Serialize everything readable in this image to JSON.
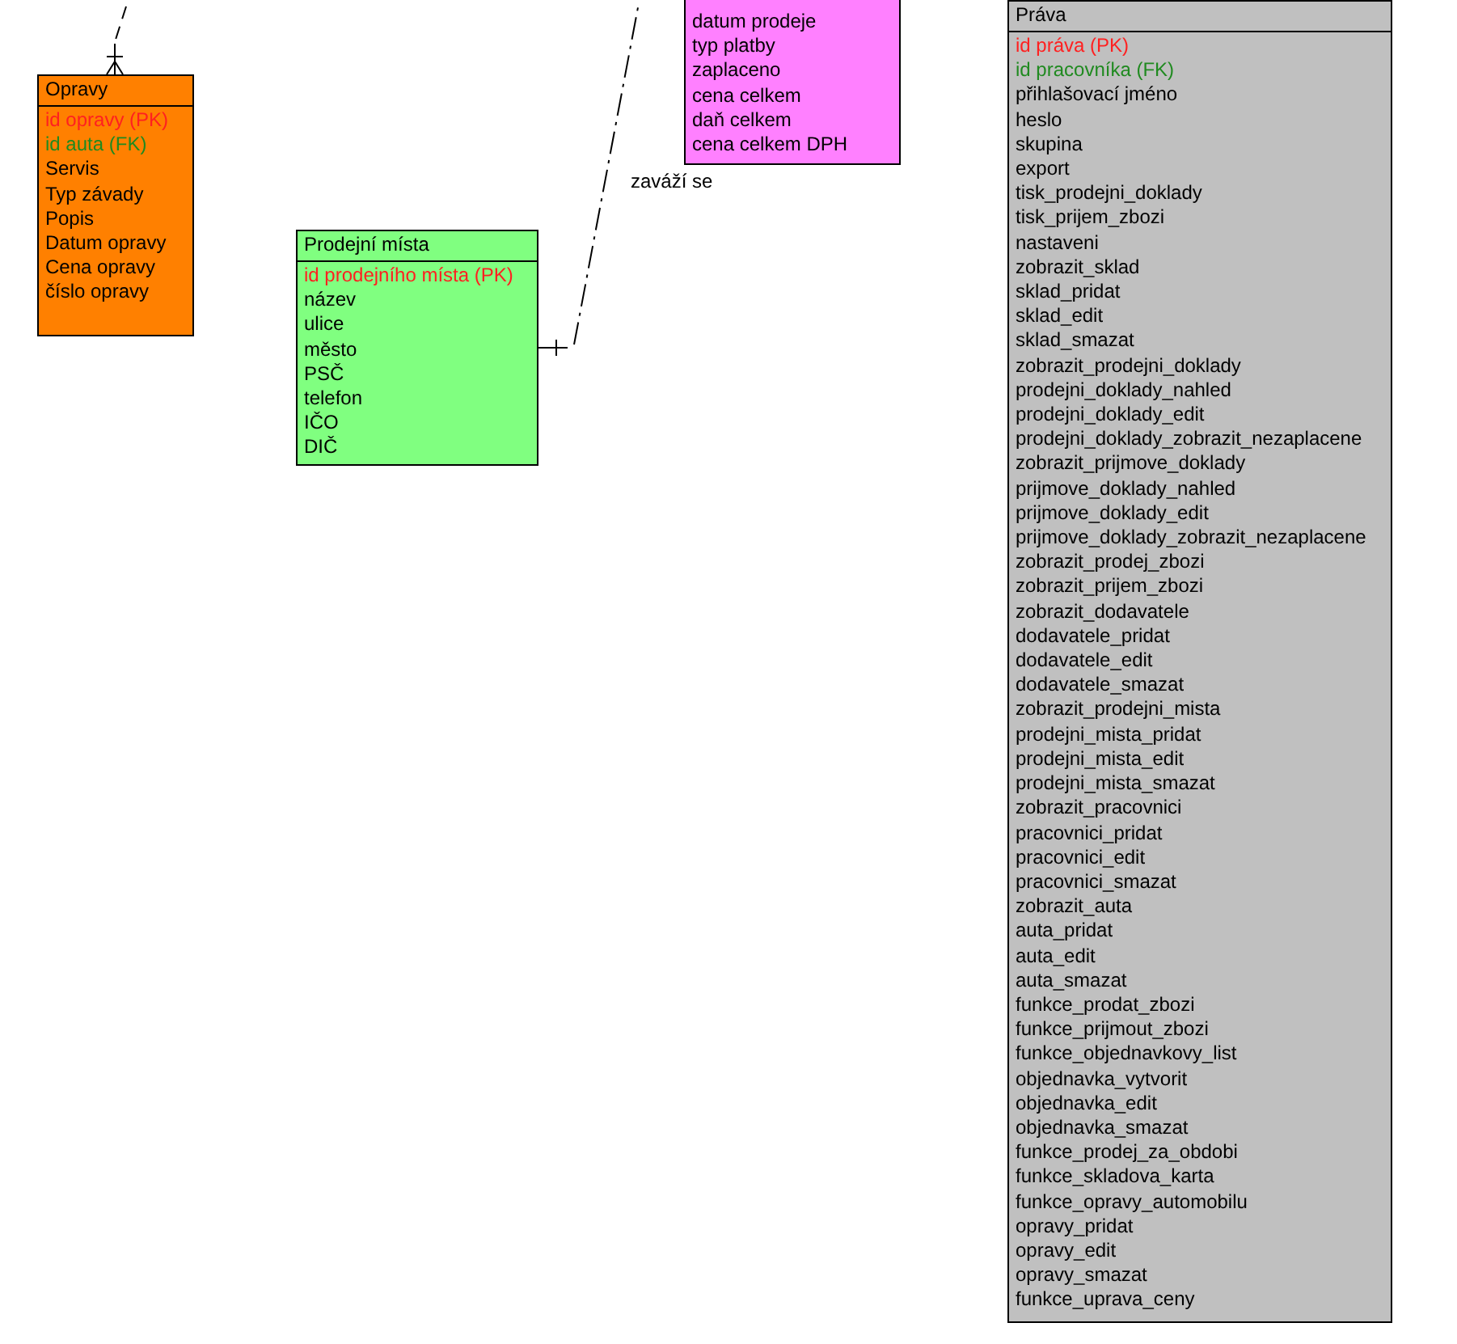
{
  "entities": [
    {
      "title": "Opravy",
      "color": "#ff8000",
      "rows": [
        {
          "text": "id opravy (PK)",
          "kind": "pk"
        },
        {
          "text": "id auta (FK)",
          "kind": "fk"
        },
        {
          "text": "Servis",
          "kind": "attr"
        },
        {
          "text": "Typ závady",
          "kind": "attr"
        },
        {
          "text": "Popis",
          "kind": "attr"
        },
        {
          "text": "Datum opravy",
          "kind": "attr"
        },
        {
          "text": "Cena opravy",
          "kind": "attr"
        },
        {
          "text": "číslo opravy",
          "kind": "attr"
        }
      ]
    },
    {
      "title": "Prodejní místa",
      "color": "#80ff80",
      "rows": [
        {
          "text": "id prodejního místa (PK)",
          "kind": "pk"
        },
        {
          "text": "název",
          "kind": "attr"
        },
        {
          "text": "ulice",
          "kind": "attr"
        },
        {
          "text": "město",
          "kind": "attr"
        },
        {
          "text": "PSČ",
          "kind": "attr"
        },
        {
          "text": "telefon",
          "kind": "attr"
        },
        {
          "text": "IČO",
          "kind": "attr"
        },
        {
          "text": "DIČ",
          "kind": "attr"
        }
      ]
    },
    {
      "color": "#ff80ff",
      "rows": [
        {
          "text": "datum prodeje",
          "kind": "attr"
        },
        {
          "text": "typ platby",
          "kind": "attr"
        },
        {
          "text": "zaplaceno",
          "kind": "attr"
        },
        {
          "text": "cena celkem",
          "kind": "attr"
        },
        {
          "text": "daň celkem",
          "kind": "attr"
        },
        {
          "text": "cena celkem DPH",
          "kind": "attr"
        }
      ]
    },
    {
      "title": "Práva",
      "color": "#c0c0c0",
      "rows": [
        {
          "text": "id práva (PK)",
          "kind": "pk"
        },
        {
          "text": "id pracovníka (FK)",
          "kind": "fk"
        },
        {
          "text": "přihlašovací jméno",
          "kind": "attr"
        },
        {
          "text": "heslo",
          "kind": "attr"
        },
        {
          "text": "skupina",
          "kind": "attr"
        },
        {
          "text": "export",
          "kind": "attr"
        },
        {
          "text": "tisk_prodejni_doklady",
          "kind": "attr"
        },
        {
          "text": "tisk_prijem_zbozi",
          "kind": "attr"
        },
        {
          "text": "nastaveni",
          "kind": "attr"
        },
        {
          "text": "zobrazit_sklad",
          "kind": "attr"
        },
        {
          "text": "sklad_pridat",
          "kind": "attr"
        },
        {
          "text": "sklad_edit",
          "kind": "attr"
        },
        {
          "text": "sklad_smazat",
          "kind": "attr"
        },
        {
          "text": "zobrazit_prodejni_doklady",
          "kind": "attr"
        },
        {
          "text": "prodejni_doklady_nahled",
          "kind": "attr"
        },
        {
          "text": "prodejni_doklady_edit",
          "kind": "attr"
        },
        {
          "text": "prodejni_doklady_zobrazit_nezaplacene",
          "kind": "attr"
        },
        {
          "text": "zobrazit_prijmove_doklady",
          "kind": "attr"
        },
        {
          "text": "prijmove_doklady_nahled",
          "kind": "attr"
        },
        {
          "text": "prijmove_doklady_edit",
          "kind": "attr"
        },
        {
          "text": "prijmove_doklady_zobrazit_nezaplacene",
          "kind": "attr"
        },
        {
          "text": "zobrazit_prodej_zbozi",
          "kind": "attr"
        },
        {
          "text": "zobrazit_prijem_zbozi",
          "kind": "attr"
        },
        {
          "text": "zobrazit_dodavatele",
          "kind": "attr"
        },
        {
          "text": "dodavatele_pridat",
          "kind": "attr"
        },
        {
          "text": "dodavatele_edit",
          "kind": "attr"
        },
        {
          "text": "dodavatele_smazat",
          "kind": "attr"
        },
        {
          "text": "zobrazit_prodejni_mista",
          "kind": "attr"
        },
        {
          "text": "prodejni_mista_pridat",
          "kind": "attr"
        },
        {
          "text": "prodejni_mista_edit",
          "kind": "attr"
        },
        {
          "text": "prodejni_mista_smazat",
          "kind": "attr"
        },
        {
          "text": "zobrazit_pracovnici",
          "kind": "attr"
        },
        {
          "text": "pracovnici_pridat",
          "kind": "attr"
        },
        {
          "text": "pracovnici_edit",
          "kind": "attr"
        },
        {
          "text": "pracovnici_smazat",
          "kind": "attr"
        },
        {
          "text": "zobrazit_auta",
          "kind": "attr"
        },
        {
          "text": "auta_pridat",
          "kind": "attr"
        },
        {
          "text": "auta_edit",
          "kind": "attr"
        },
        {
          "text": "auta_smazat",
          "kind": "attr"
        },
        {
          "text": "funkce_prodat_zbozi",
          "kind": "attr"
        },
        {
          "text": "funkce_prijmout_zbozi",
          "kind": "attr"
        },
        {
          "text": "funkce_objednavkovy_list",
          "kind": "attr"
        },
        {
          "text": "objednavka_vytvorit",
          "kind": "attr"
        },
        {
          "text": "objednavka_edit",
          "kind": "attr"
        },
        {
          "text": "objednavka_smazat",
          "kind": "attr"
        },
        {
          "text": "funkce_prodej_za_obdobi",
          "kind": "attr"
        },
        {
          "text": "funkce_skladova_karta",
          "kind": "attr"
        },
        {
          "text": "funkce_opravy_automobilu",
          "kind": "attr"
        },
        {
          "text": "opravy_pridat",
          "kind": "attr"
        },
        {
          "text": "opravy_edit",
          "kind": "attr"
        },
        {
          "text": "opravy_smazat",
          "kind": "attr"
        },
        {
          "text": "funkce_uprava_ceny",
          "kind": "attr"
        }
      ]
    }
  ],
  "relationship_label": "zaváží se"
}
